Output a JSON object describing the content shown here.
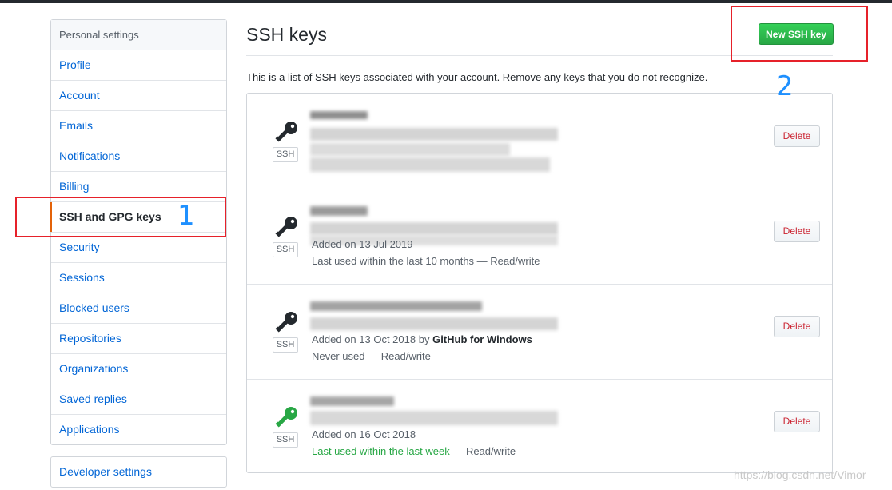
{
  "sidebar": {
    "header": "Personal settings",
    "items": [
      {
        "label": "Profile"
      },
      {
        "label": "Account"
      },
      {
        "label": "Emails"
      },
      {
        "label": "Notifications"
      },
      {
        "label": "Billing"
      },
      {
        "label": "SSH and GPG keys",
        "selected": true
      },
      {
        "label": "Security"
      },
      {
        "label": "Sessions"
      },
      {
        "label": "Blocked users"
      },
      {
        "label": "Repositories"
      },
      {
        "label": "Organizations"
      },
      {
        "label": "Saved replies"
      },
      {
        "label": "Applications"
      }
    ],
    "developer_settings": "Developer settings"
  },
  "main": {
    "title": "SSH keys",
    "new_key_button": "New SSH key",
    "intro": "This is a list of SSH keys associated with your account. Remove any keys that you do not recognize.",
    "keys": [
      {
        "type_label": "SSH",
        "icon": "key-icon",
        "icon_color": "#24292e",
        "added_prefix": "",
        "added_by": "",
        "last_used": "",
        "last_used_suffix": "",
        "delete_label": "Delete"
      },
      {
        "type_label": "SSH",
        "icon": "key-icon",
        "icon_color": "#24292e",
        "added_prefix": "Added on 13 Jul 2019",
        "added_by": "",
        "last_used": "Last used within the last 10 months — Read/write",
        "last_used_suffix": "",
        "delete_label": "Delete"
      },
      {
        "type_label": "SSH",
        "icon": "key-icon",
        "icon_color": "#24292e",
        "added_prefix": "Added on 13 Oct 2018 by",
        "added_by": "GitHub for Windows",
        "last_used": "Never used — Read/write",
        "last_used_suffix": "",
        "delete_label": "Delete"
      },
      {
        "type_label": "SSH",
        "icon": "key-icon",
        "icon_color": "#28a745",
        "added_prefix": "Added on 16 Oct 2018",
        "added_by": "",
        "last_used": "Last used within the last week",
        "last_used_suffix": " — Read/write",
        "delete_label": "Delete"
      }
    ]
  },
  "annotations": {
    "one": "1",
    "two": "2",
    "color": "#e6212a",
    "number_color": "#1e90ff"
  },
  "watermark": "https://blog.csdn.net/Vimor",
  "colors": {
    "link": "#0366d6",
    "selected_bar": "#e36209",
    "primary_button": "#28a745",
    "danger": "#cb2431"
  }
}
